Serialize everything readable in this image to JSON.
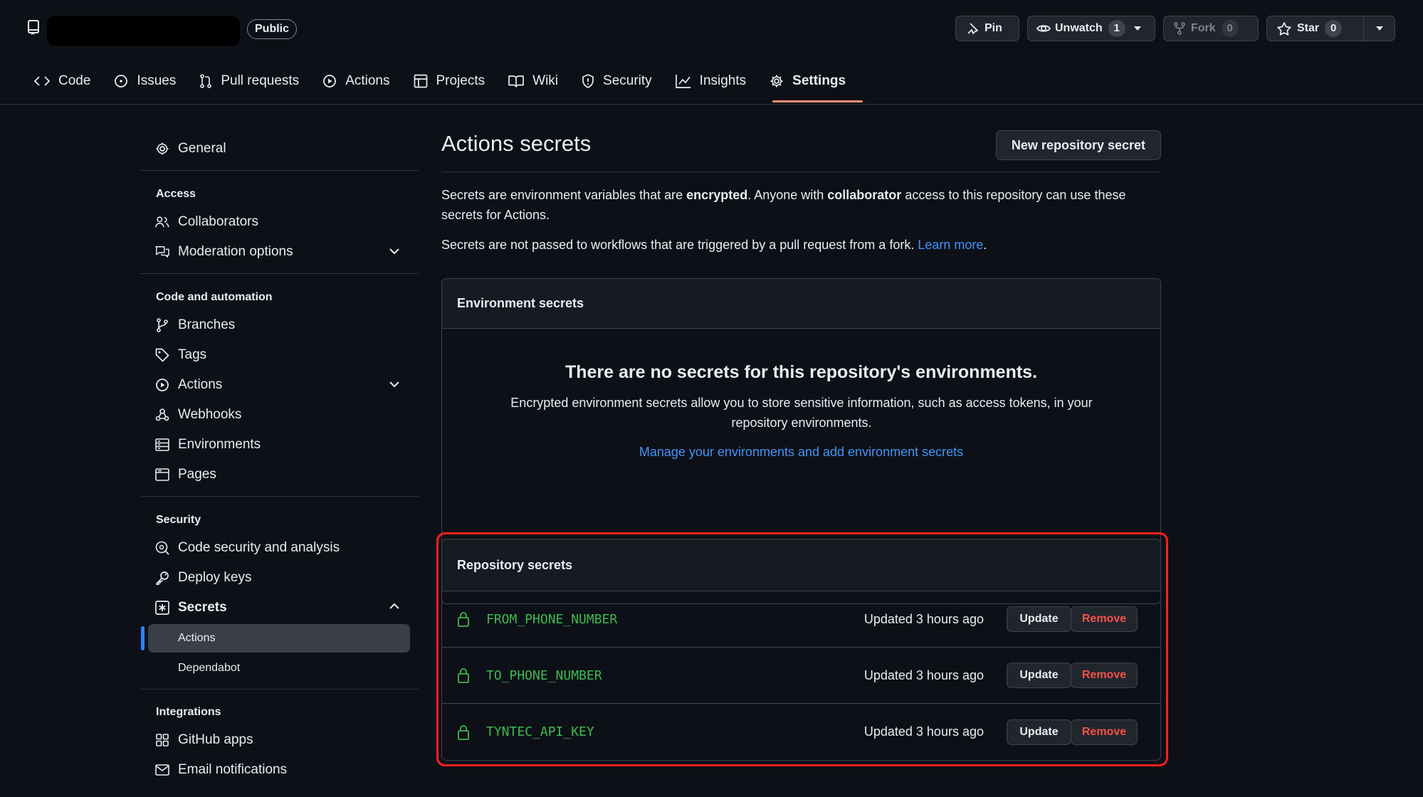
{
  "repo": {
    "visibility": "Public"
  },
  "header_buttons": {
    "pin": "Pin",
    "unwatch": "Unwatch",
    "unwatch_count": "1",
    "fork": "Fork",
    "fork_count": "0",
    "star": "Star",
    "star_count": "0"
  },
  "tabs": [
    "Code",
    "Issues",
    "Pull requests",
    "Actions",
    "Projects",
    "Wiki",
    "Security",
    "Insights",
    "Settings"
  ],
  "active_tab": "Settings",
  "sidebar": {
    "general": "General",
    "access_heading": "Access",
    "collaborators": "Collaborators",
    "moderation": "Moderation options",
    "code_heading": "Code and automation",
    "branches": "Branches",
    "tags": "Tags",
    "actions": "Actions",
    "webhooks": "Webhooks",
    "environments": "Environments",
    "pages": "Pages",
    "security_heading": "Security",
    "code_security": "Code security and analysis",
    "deploy_keys": "Deploy keys",
    "secrets": "Secrets",
    "secrets_actions": "Actions",
    "secrets_dependabot": "Dependabot",
    "integrations_heading": "Integrations",
    "github_apps": "GitHub apps",
    "email_notifications": "Email notifications"
  },
  "main": {
    "title": "Actions secrets",
    "new_secret_button": "New repository secret",
    "intro_1": "Secrets are environment variables that are ",
    "intro_bold_1": "encrypted",
    "intro_2": ". Anyone with ",
    "intro_bold_2": "collaborator",
    "intro_3": " access to this repository can use these secrets for Actions.",
    "intro_line2": "Secrets are not passed to workflows that are triggered by a pull request from a fork. ",
    "learn_more": "Learn more",
    "env_box": {
      "heading": "Environment secrets",
      "empty_title": "There are no secrets for this repository's environments.",
      "empty_desc": "Encrypted environment secrets allow you to store sensitive information, such as access tokens, in your repository environments.",
      "manage_link": "Manage your environments and add environment secrets"
    },
    "repo_box": {
      "heading": "Repository secrets",
      "update_label": "Update",
      "remove_label": "Remove",
      "secrets": [
        {
          "name": "FROM_PHONE_NUMBER",
          "updated": "Updated 3 hours ago"
        },
        {
          "name": "TO_PHONE_NUMBER",
          "updated": "Updated 3 hours ago"
        },
        {
          "name": "TYNTEC_API_KEY",
          "updated": "Updated 3 hours ago"
        }
      ]
    }
  },
  "colors": {
    "accent_link": "#4493f8",
    "secret_name": "#3fb950",
    "remove": "#f85149",
    "tab_underline": "#fd8c73",
    "highlight": "#ff1f1f"
  }
}
